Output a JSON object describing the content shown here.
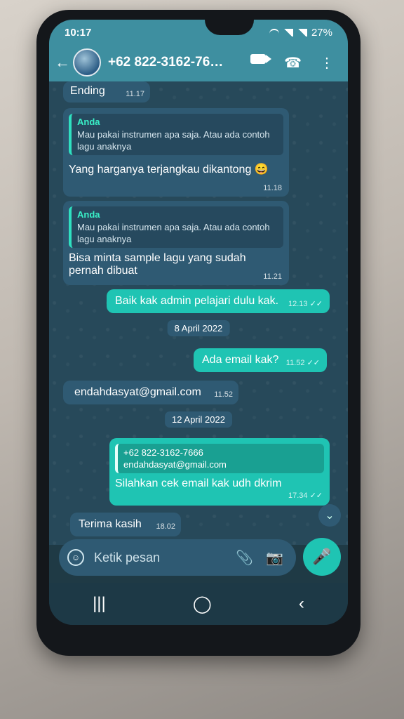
{
  "status": {
    "time": "10:17",
    "battery": "27%"
  },
  "header": {
    "back": "←",
    "contact": "+62 822-3162-76…",
    "video_icon": "video-icon",
    "phone_icon": "☎",
    "more_icon": "⋮"
  },
  "messages": [
    {
      "type": "in",
      "text": "Ending",
      "time": "11.17"
    },
    {
      "type": "in",
      "quote_name": "Anda",
      "quote_text": "Mau pakai instrumen apa saja. Atau ada contoh lagu anaknya",
      "text": "Yang harganya terjangkau dikantong 😄",
      "time": "11.18"
    },
    {
      "type": "in",
      "quote_name": "Anda",
      "quote_text": "Mau pakai instrumen apa saja. Atau ada contoh lagu anaknya",
      "text": "Bisa minta sample lagu yang sudah pernah dibuat",
      "time": "11.21"
    },
    {
      "type": "out",
      "text": "Baik kak admin pelajari dulu kak.",
      "time": "12.13",
      "ticks": "✓✓"
    },
    {
      "type": "date",
      "text": "8 April 2022"
    },
    {
      "type": "out",
      "text": "Ada email kak?",
      "time": "11.52",
      "ticks": "✓✓"
    },
    {
      "type": "in",
      "text": "endahdasyat@gmail.com",
      "time": "11.52"
    },
    {
      "type": "date",
      "text": "12 April 2022"
    },
    {
      "type": "out",
      "quote_line1": "+62 822-3162-7666",
      "quote_line2": "endahdasyat@gmail.com",
      "text": "Silahkan cek email kak udh dkrim",
      "time": "17.34",
      "ticks": "✓✓"
    },
    {
      "type": "in",
      "text": "Terima kasih",
      "time": "18.02"
    }
  ],
  "input": {
    "placeholder": "Ketik pesan",
    "emoji_icon": "emoji-icon",
    "attach_icon": "📎",
    "camera_icon": "📷",
    "mic_icon": "🎤"
  },
  "scroll_down_icon": "chevron-double-down-icon",
  "nav": {
    "recents": "|||",
    "home": "◯",
    "back": "‹"
  }
}
